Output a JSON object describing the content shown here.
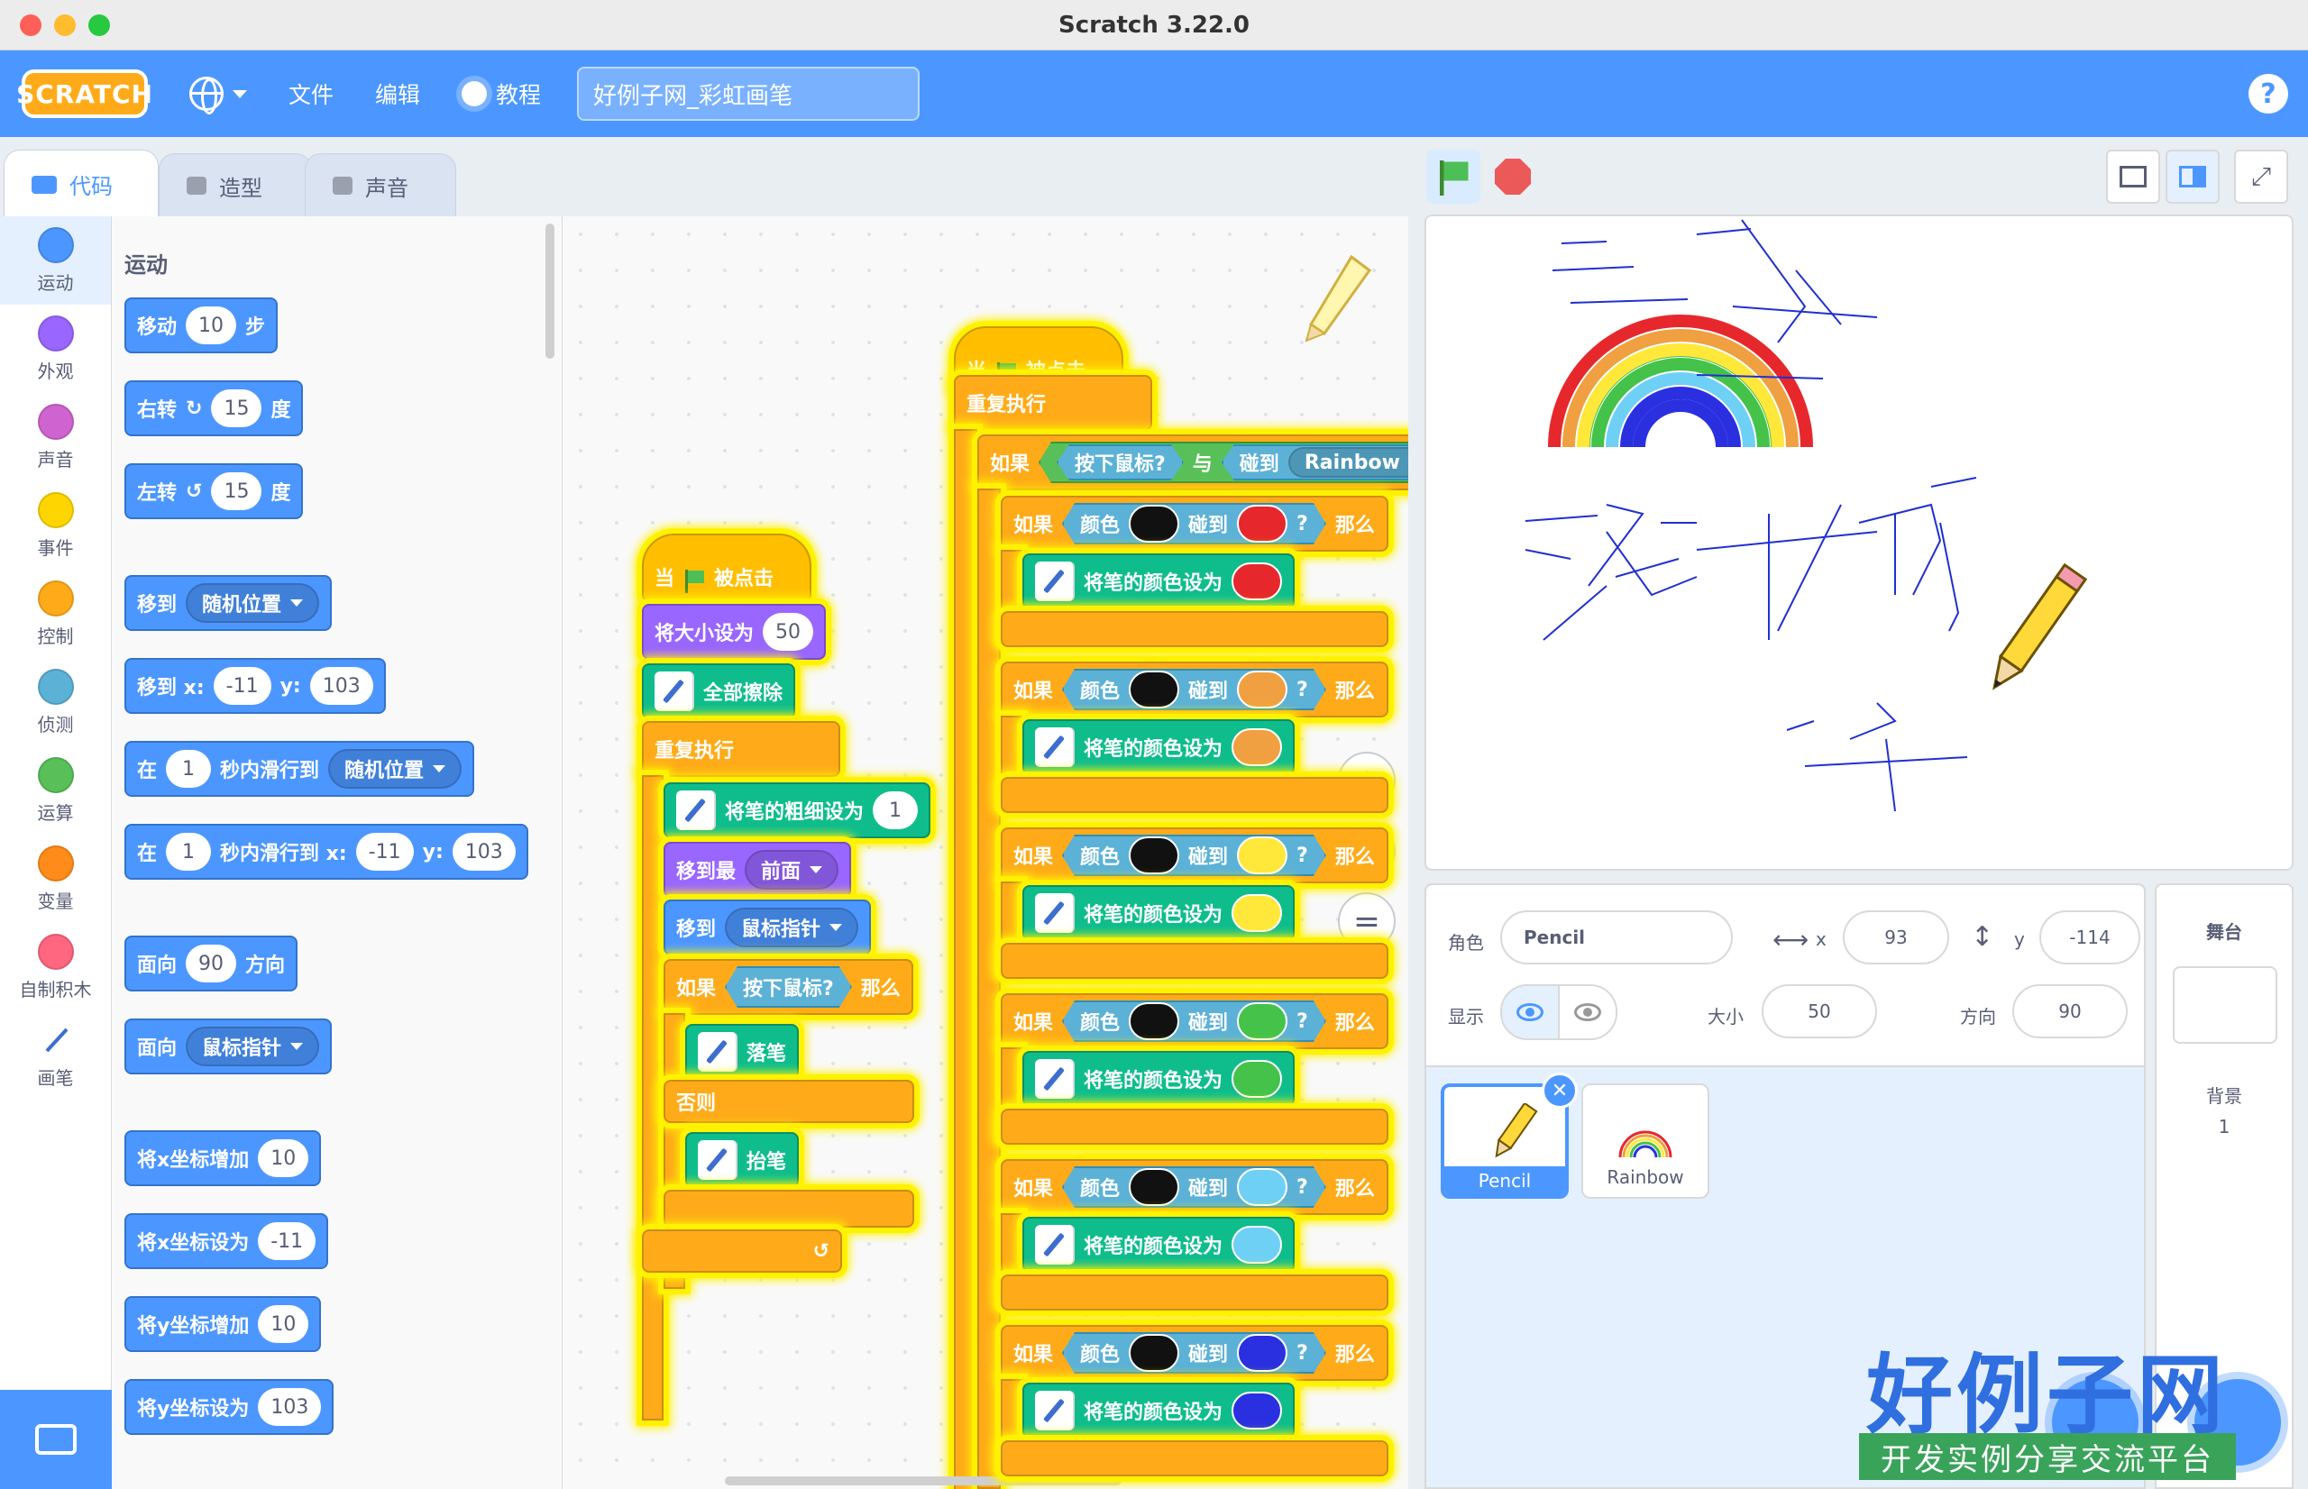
{
  "window": {
    "title": "Scratch 3.22.0"
  },
  "menubar": {
    "logo": "SCRATCH",
    "file": "文件",
    "edit": "编辑",
    "tutorials": "教程",
    "project_title": "好例子网_彩虹画笔",
    "help": "?"
  },
  "tabs": {
    "code": "代码",
    "costumes": "造型",
    "sounds": "声音"
  },
  "categories": [
    {
      "label": "运动",
      "color": "#4c97ff"
    },
    {
      "label": "外观",
      "color": "#9966ff"
    },
    {
      "label": "声音",
      "color": "#cf63cf"
    },
    {
      "label": "事件",
      "color": "#ffd500"
    },
    {
      "label": "控制",
      "color": "#ffab19"
    },
    {
      "label": "侦测",
      "color": "#5cb1d6"
    },
    {
      "label": "运算",
      "color": "#59c059"
    },
    {
      "label": "变量",
      "color": "#ff8c1a"
    },
    {
      "label": "自制积木",
      "color": "#ff6680"
    },
    {
      "label": "画笔",
      "color": "#0fbd8c"
    }
  ],
  "palette": {
    "title": "运动",
    "move": {
      "a": "移动",
      "n": "10",
      "b": "步"
    },
    "turn_right": {
      "a": "右转",
      "n": "15",
      "b": "度"
    },
    "turn_left": {
      "a": "左转",
      "n": "15",
      "b": "度"
    },
    "goto": {
      "a": "移到",
      "drop": "随机位置"
    },
    "goto_xy": {
      "a": "移到 x:",
      "x": "-11",
      "b": "y:",
      "y": "103"
    },
    "glide": {
      "a": "在",
      "n": "1",
      "b": "秒内滑行到",
      "drop": "随机位置"
    },
    "glide_xy": {
      "a": "在",
      "n": "1",
      "b": "秒内滑行到 x:",
      "x": "-11",
      "c": "y:",
      "y": "103"
    },
    "point_dir": {
      "a": "面向",
      "n": "90",
      "b": "方向"
    },
    "point_towards": {
      "a": "面向",
      "drop": "鼠标指针"
    },
    "change_x": {
      "a": "将x坐标增加",
      "n": "10"
    },
    "set_x": {
      "a": "将x坐标设为",
      "n": "-11"
    },
    "change_y": {
      "a": "将y坐标增加",
      "n": "10"
    },
    "set_y": {
      "a": "将y坐标设为",
      "n": "103"
    }
  },
  "script1": {
    "hat": {
      "a": "当",
      "b": "被点击"
    },
    "set_size": {
      "a": "将大小设为",
      "n": "50"
    },
    "clear": "全部擦除",
    "forever": "重复执行",
    "pen_size": {
      "a": "将笔的粗细设为",
      "n": "1"
    },
    "front": {
      "a": "移到最",
      "drop": "前面"
    },
    "goto_mouse": {
      "a": "移到",
      "drop": "鼠标指针"
    },
    "if_mouse": {
      "a": "如果",
      "cond": "按下鼠标?",
      "b": "那么"
    },
    "pen_down": "落笔",
    "else": "否则",
    "pen_up": "抬笔"
  },
  "script2": {
    "hat": {
      "a": "当",
      "b": "被点击"
    },
    "forever": "重复执行",
    "outer_if": {
      "a": "如果",
      "cond": "按下鼠标?",
      "and": "与",
      "touch": "碰到",
      "drop": "Rainbow"
    },
    "rows": [
      {
        "if": "如果",
        "color": "颜色",
        "touch": "碰到",
        "q": "?",
        "then": "那么",
        "set": "将笔的颜色设为",
        "c": "#e6282c"
      },
      {
        "if": "如果",
        "color": "颜色",
        "touch": "碰到",
        "q": "?",
        "then": "那么",
        "set": "将笔的颜色设为",
        "c": "#f0a040"
      },
      {
        "if": "如果",
        "color": "颜色",
        "touch": "碰到",
        "q": "?",
        "then": "那么",
        "set": "将笔的颜色设为",
        "c": "#ffe83a"
      },
      {
        "if": "如果",
        "color": "颜色",
        "touch": "碰到",
        "q": "?",
        "then": "那么",
        "set": "将笔的颜色设为",
        "c": "#44c24a"
      },
      {
        "if": "如果",
        "color": "颜色",
        "touch": "碰到",
        "q": "?",
        "then": "那么",
        "set": "将笔的颜色设为",
        "c": "#6fd0f5"
      },
      {
        "if": "如果",
        "color": "颜色",
        "touch": "碰到",
        "q": "?",
        "then": "那么",
        "set": "将笔的颜色设为",
        "c": "#2a30e0"
      }
    ]
  },
  "zoom": {
    "in": "+",
    "out": "−",
    "reset": "="
  },
  "sprite_info": {
    "sprite_label": "角色",
    "sprite_name": "Pencil",
    "x_label": "x",
    "x": "93",
    "y_label": "y",
    "y": "-114",
    "show_label": "显示",
    "size_label": "大小",
    "size": "50",
    "dir_label": "方向",
    "dir": "90"
  },
  "sprites": [
    {
      "name": "Pencil"
    },
    {
      "name": "Rainbow"
    }
  ],
  "backdrop": {
    "title": "舞台",
    "label": "背景",
    "count": "1"
  },
  "watermark": {
    "title": "好例子网",
    "subtitle": "开发实例分享交流平台"
  }
}
